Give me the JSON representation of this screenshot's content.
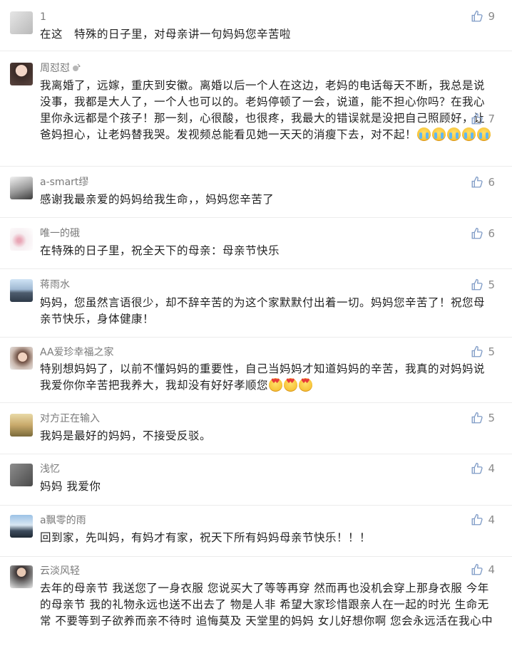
{
  "accent": "#8a8a8a",
  "comments": [
    {
      "username": "1",
      "likes": "9",
      "text": "在这　特殊的日子里，对母亲讲一句妈妈您辛苦啦"
    },
    {
      "username": "周怼怼",
      "badge": "badge-icon",
      "likes": "7",
      "text": "我离婚了，远嫁，重庆到安徽。离婚以后一个人在这边，老妈的电话每天不断，我总是说没事，我都是大人了，一个人也可以的。老妈停顿了一会，说道，能不担心你吗？在我心里你永远都是个孩子！那一刻，心很酸，也很疼，我最大的错误就是没把自己照顾好，让爸妈担心，让老妈替我哭。发视频总能看见她一天天的消瘦下去，对不起！",
      "emoji": "crying-emoji",
      "emoji_count": 5
    },
    {
      "username": "a-smart缪",
      "likes": "6",
      "text": "感谢我最亲爱的妈妈给我生命，，妈妈您辛苦了"
    },
    {
      "username": "唯一的硪",
      "likes": "6",
      "text": "在特殊的日子里，祝全天下的母亲：母亲节快乐"
    },
    {
      "username": "蒋雨水",
      "likes": "5",
      "text": "妈妈，您虽然言语很少，却不辞辛苦的为这个家默默付出着一切。妈妈您辛苦了！祝您母亲节快乐，身体健康！"
    },
    {
      "username": "AA爱珍幸福之家",
      "likes": "5",
      "text": "特别想妈妈了，以前不懂妈妈的重要性，自己当妈妈才知道妈妈的辛苦，我真的对妈妈说我爱你你辛苦把我养大，我却没有好好孝顺您",
      "emoji": "heart-eyes-emoji",
      "emoji_count": 3
    },
    {
      "username": "对方正在输入",
      "likes": "5",
      "text": "我妈是最好的妈妈，不接受反驳。"
    },
    {
      "username": "浅忆",
      "likes": "4",
      "text": "妈妈 我爱你"
    },
    {
      "username": "a飘零的雨",
      "likes": "4",
      "text": "回到家，先叫妈，有妈才有家，祝天下所有妈妈母亲节快乐！！！"
    },
    {
      "username": "云淡风轻",
      "likes": "4",
      "text": "去年的母亲节 我送您了一身衣服 您说买大了等等再穿 然而再也没机会穿上那身衣服 今年的母亲节 我的礼物永远也送不出去了 物是人非 希望大家珍惜跟亲人在一起的时光 生命无常 不要等到子欲养而亲不待时 追悔莫及 天堂里的妈妈 女儿好想你啊 您会永远活在我心中"
    }
  ]
}
